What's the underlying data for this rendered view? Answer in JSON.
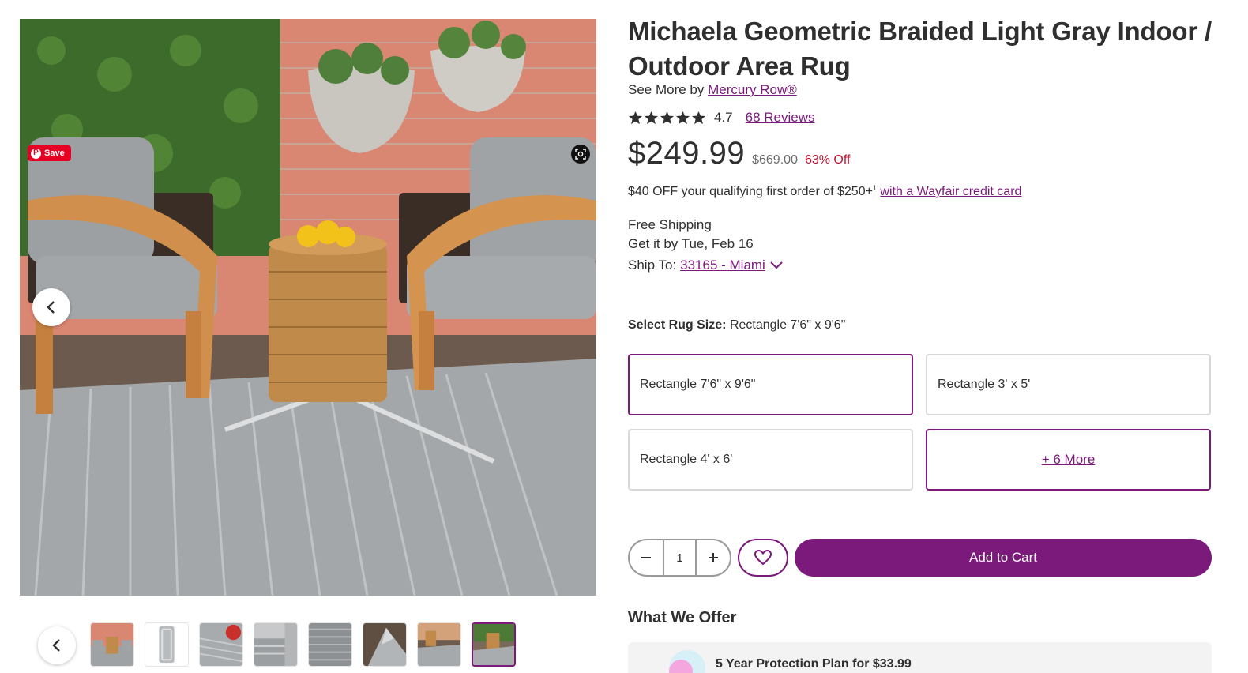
{
  "gallery": {
    "pinterest_label": "Save",
    "pinterest_icon": "pinterest-icon",
    "visual_search_icon": "camera-search-icon",
    "prev_icon": "chevron-left-icon",
    "thumbnail_count": 8,
    "active_thumbnail": 8
  },
  "product": {
    "title": "Michaela Geometric Braided Light Gray Indoor / Outdoor Area Rug",
    "see_more_prefix": "See More by",
    "brand": "Mercury Row®",
    "rating": "4.7",
    "rating_stars": 5,
    "reviews_label": "68 Reviews",
    "price": "$249.99",
    "was_price": "$669.00",
    "discount": "63% Off"
  },
  "promo": {
    "text": "$40 OFF your qualifying first order of $250+",
    "footnote": "1",
    "link": "with a Wayfair credit card"
  },
  "shipping": {
    "free": "Free Shipping",
    "eta": "Get it by Tue, Feb 16",
    "ship_to_label": "Ship To:",
    "location": "33165 - Miami"
  },
  "size": {
    "label": "Select Rug Size:",
    "selected": "Rectangle 7'6\" x 9'6\"",
    "options": [
      "Rectangle 7'6\" x 9'6\"",
      "Rectangle 3' x 5'",
      "Rectangle 4' x 6'"
    ],
    "more": "+ 6 More"
  },
  "cart": {
    "quantity": "1",
    "minus": "−",
    "plus": "+",
    "add_label": "Add to Cart"
  },
  "offer": {
    "heading": "What We Offer",
    "item": "5 Year Protection Plan for $33.99"
  },
  "colors": {
    "brand": "#7b1a7a",
    "sale": "#c4122f",
    "pinterest": "#e60023"
  }
}
